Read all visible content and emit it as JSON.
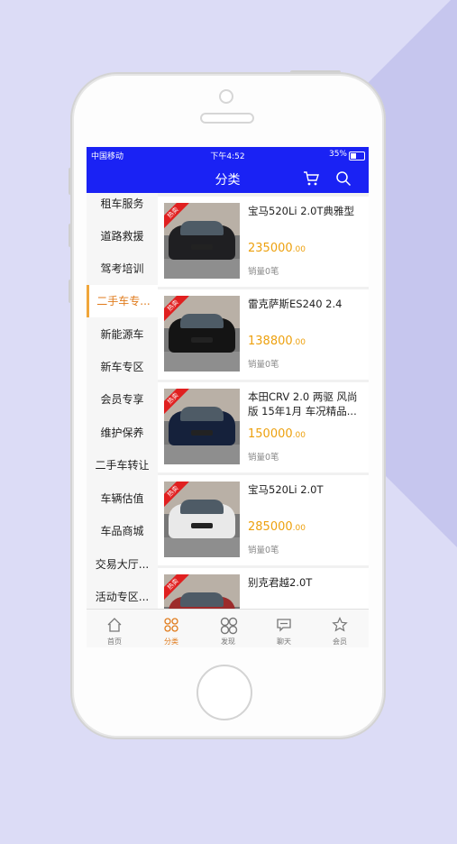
{
  "status_bar": {
    "carrier": "中国移动",
    "time": "下午4:52",
    "battery": "35%"
  },
  "nav": {
    "title": "分类",
    "icons": [
      "cart-icon",
      "search-icon"
    ]
  },
  "sidebar": {
    "items": [
      {
        "label": "租车服务"
      },
      {
        "label": "道路救援"
      },
      {
        "label": "驾考培训"
      },
      {
        "label": "二手车专..."
      },
      {
        "label": "新能源车"
      },
      {
        "label": "新车专区"
      },
      {
        "label": "会员专享"
      },
      {
        "label": "维护保养"
      },
      {
        "label": "二手车转让"
      },
      {
        "label": "车辆估值"
      },
      {
        "label": "车品商城"
      },
      {
        "label": "交易大厅..."
      },
      {
        "label": "活动专区..."
      }
    ],
    "active_index": 3
  },
  "products": [
    {
      "badge": "热卖",
      "title": "宝马520Li 2.0T典雅型",
      "price": "235000",
      "price_decimals": ".00",
      "sales": "销量0笔",
      "car_color": "#1f1f22"
    },
    {
      "badge": "热卖",
      "title": "雷克萨斯ES240 2.4",
      "price": "138800",
      "price_decimals": ".00",
      "sales": "销量0笔",
      "car_color": "#141414"
    },
    {
      "badge": "热卖",
      "title": "本田CRV 2.0 两驱 风尚版 15年1月 车况精品...",
      "price": "150000",
      "price_decimals": ".00",
      "sales": "销量0笔",
      "car_color": "#15213b"
    },
    {
      "badge": "热卖",
      "title": "宝马520Li 2.0T",
      "price": "285000",
      "price_decimals": ".00",
      "sales": "销量0笔",
      "car_color": "#e9e9e9"
    },
    {
      "badge": "热卖",
      "title": "别克君越2.0T",
      "price": "",
      "price_decimals": "",
      "sales": "",
      "car_color": "#9c2b2b"
    }
  ],
  "tabbar": {
    "items": [
      {
        "label": "首页",
        "icon": "home-icon"
      },
      {
        "label": "分类",
        "icon": "grid-icon"
      },
      {
        "label": "发现",
        "icon": "discover-icon"
      },
      {
        "label": "聊天",
        "icon": "chat-icon"
      },
      {
        "label": "会员",
        "icon": "star-icon"
      }
    ],
    "active_index": 1
  },
  "colors": {
    "nav_blue": "#1a22f4",
    "accent_orange": "#e07b1c",
    "price_gold": "#eda10f"
  }
}
